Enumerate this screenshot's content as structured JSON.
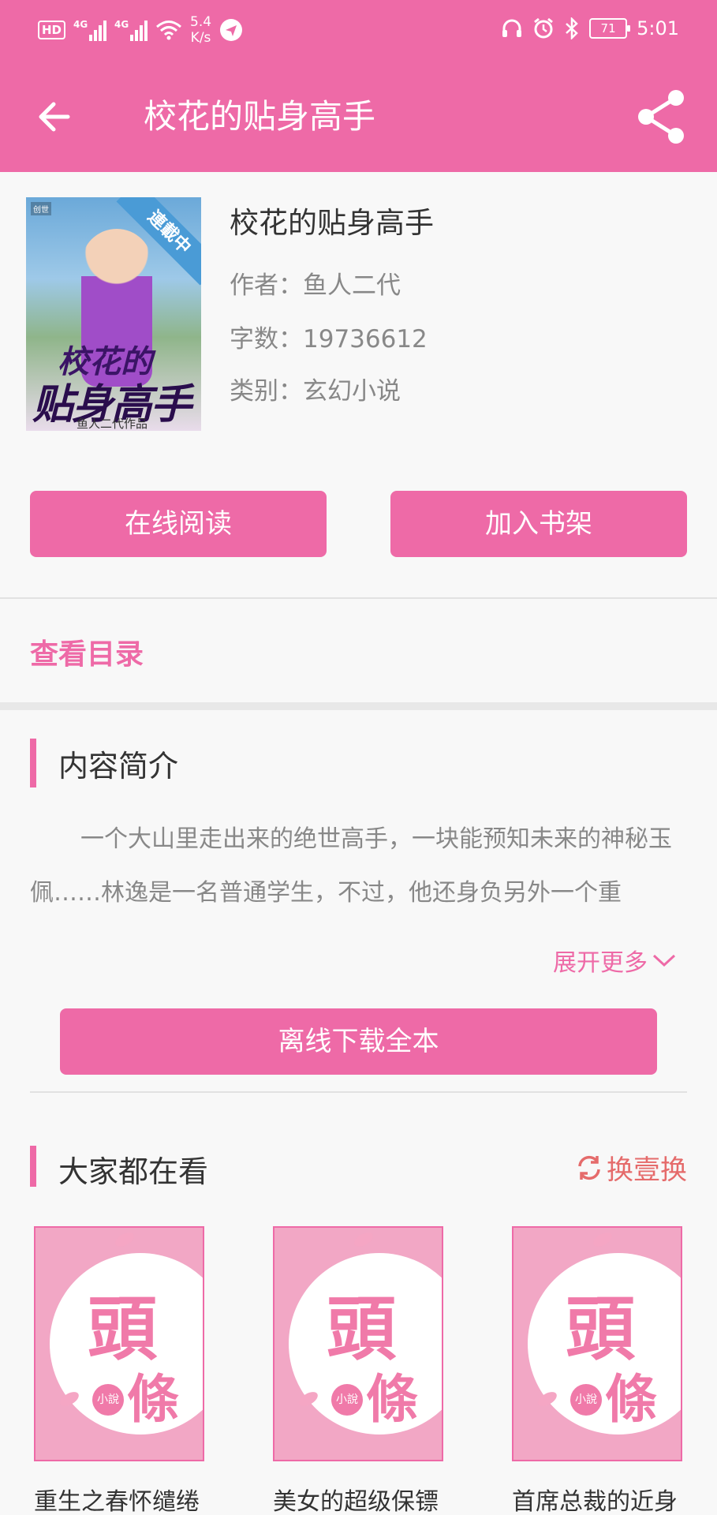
{
  "status_bar": {
    "hd": "HD",
    "net1": "4G",
    "net2": "4G",
    "speed_value": "5.4",
    "speed_unit": "K/s",
    "battery": "71",
    "time": "5:01"
  },
  "app_bar": {
    "title": "校花的贴身高手"
  },
  "book": {
    "title": "校花的贴身高手",
    "author_label": "作者：",
    "author": "鱼人二代",
    "words_label": "字数：",
    "words": "19736612",
    "category_label": "类别：",
    "category": "玄幻小说",
    "cover": {
      "ribbon": "連載中",
      "title_line1": "校花的",
      "title_line2": "贴身高手",
      "author_tag": "鱼人二代作品"
    }
  },
  "actions": {
    "read_online": "在线阅读",
    "add_shelf": "加入书架"
  },
  "catalog_link": "查看目录",
  "intro": {
    "title": "内容简介",
    "text": "一个大山里走出来的绝世高手，一块能预知未来的神秘玉佩……林逸是一名普通学生，不过，他还身负另外一个重",
    "expand": "展开更多"
  },
  "download_button": "离线下载全本",
  "recommend": {
    "title": "大家都在看",
    "refresh": "换壹换",
    "cover_text1": "頭",
    "cover_text2": "條",
    "cover_badge": "小說",
    "items": [
      {
        "name": "重生之春怀缱绻"
      },
      {
        "name": "美女的超级保镖"
      },
      {
        "name": "首席总裁的近身"
      }
    ]
  },
  "colors": {
    "primary": "#ee6aa7",
    "refresh": "#e56b6b",
    "text": "#333333",
    "muted": "#888888"
  },
  "icons": {
    "back": "arrow-left-icon",
    "share": "share-icon",
    "expand": "chevron-down-icon",
    "refresh": "refresh-icon"
  }
}
